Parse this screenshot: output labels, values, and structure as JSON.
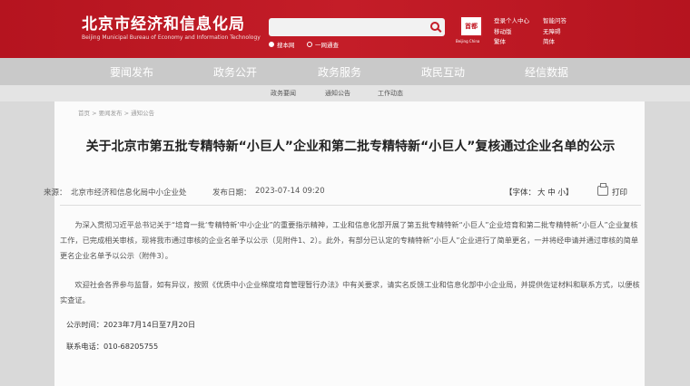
{
  "header": {
    "logo_cn": "北京市经济和信息化局",
    "logo_en": "Beijing Municipal Bureau of Economy and Information Technology",
    "scope_site": "搜本网",
    "scope_all": "一网通查",
    "emblem_text": "首都",
    "emblem_caption": "Beijing China",
    "links": [
      "登录个人中心",
      "移动版",
      "繁体",
      "智能问答",
      "无障碍",
      "简体"
    ]
  },
  "nav": {
    "items": [
      "要闻发布",
      "政务公开",
      "政务服务",
      "政民互动",
      "经信数据"
    ],
    "active_index": 0
  },
  "subnav": {
    "items": [
      "政务要闻",
      "通知公告",
      "工作动态"
    ]
  },
  "breadcrumb": "首页 > 要闻发布 > 通知公告",
  "article": {
    "title": "关于北京市第五批专精特新“小巨人”企业和第二批专精特新“小巨人”复核通过企业名单的公示",
    "source_label": "来源：",
    "source": "北京市经济和信息化局中小企业处",
    "date_label": "发布日期：",
    "date": "2023-07-14 09:20",
    "font_label": "【字体：",
    "font_sizes": "大 中 小】",
    "print_label": "打印",
    "paragraphs": [
      "为深入贯彻习近平总书记关于“培育一批‘专精特新’中小企业”的重要指示精神，工业和信息化部开展了第五批专精特新“小巨人”企业培育和第二批专精特新“小巨人”企业复核工作，已完成相关审核，现将我市通过审核的企业名单予以公示（见附件1、2）。此外，有部分已认定的专精特新“小巨人”企业进行了简单更名，一并将经申请并通过审核的简单更名企业名单予以公示（附件3）。",
      "欢迎社会各界参与监督，如有异议，按照《优质中小企业梯度培育管理暂行办法》中有关要求，请实名反馈工业和信息化部中小企业局，并提供佐证材料和联系方式，以便核实查证。"
    ],
    "period": "公示时间：2023年7月14日至7月20日",
    "phone": "联系电话：010-68205755"
  }
}
